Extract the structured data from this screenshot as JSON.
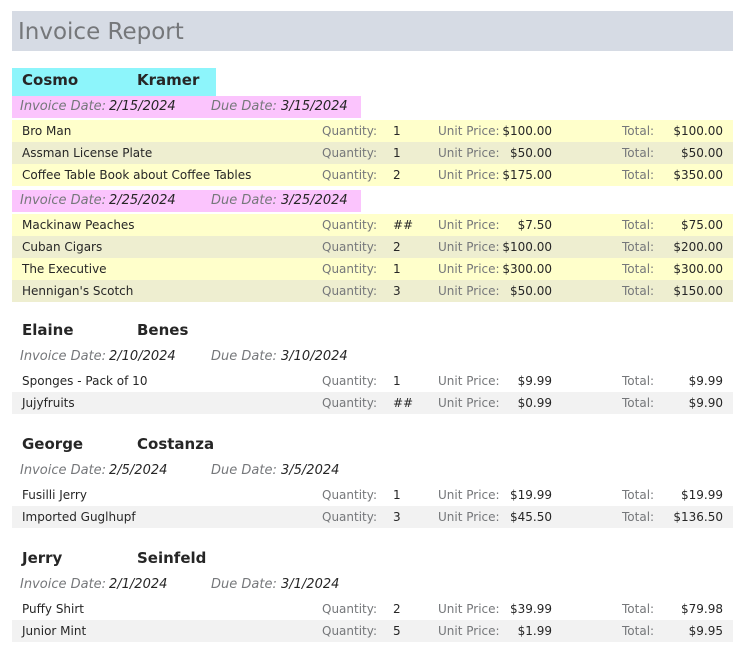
{
  "report": {
    "title": "Invoice Report"
  },
  "labels": {
    "invoice_date": "Invoice Date:",
    "due_date": "Due Date:",
    "quantity": "Quantity:",
    "unit_price": "Unit Price:",
    "total": "Total:"
  },
  "colors": {
    "title_bar": "#d6dbe4",
    "customer_highlight": "#8df5fb",
    "invoice_highlight": "#fbc4fd",
    "row_yellow_light": "#ffffcb",
    "row_yellow_dark": "#eeeed0",
    "row_gray": "#f2f2f2"
  },
  "customers": [
    {
      "first": "Cosmo",
      "last": "Kramer",
      "invoices": [
        {
          "invoice_date": "2/15/2024",
          "due_date": "3/15/2024",
          "items": [
            {
              "name": "Bro Man",
              "quantity": "1",
              "unit_price": "$100.00",
              "total": "$100.00"
            },
            {
              "name": "Assman License Plate",
              "quantity": "1",
              "unit_price": "$50.00",
              "total": "$50.00"
            },
            {
              "name": "Coffee Table Book about Coffee Tables",
              "quantity": "2",
              "unit_price": "$175.00",
              "total": "$350.00"
            }
          ]
        },
        {
          "invoice_date": "2/25/2024",
          "due_date": "3/25/2024",
          "items": [
            {
              "name": "Mackinaw Peaches",
              "quantity": "##",
              "unit_price": "$7.50",
              "total": "$75.00"
            },
            {
              "name": "Cuban Cigars",
              "quantity": "2",
              "unit_price": "$100.00",
              "total": "$200.00"
            },
            {
              "name": "The Executive",
              "quantity": "1",
              "unit_price": "$300.00",
              "total": "$300.00"
            },
            {
              "name": "Hennigan's Scotch",
              "quantity": "3",
              "unit_price": "$50.00",
              "total": "$150.00"
            }
          ]
        }
      ]
    },
    {
      "first": "Elaine",
      "last": "Benes",
      "invoices": [
        {
          "invoice_date": "2/10/2024",
          "due_date": "3/10/2024",
          "items": [
            {
              "name": "Sponges - Pack of 10",
              "quantity": "1",
              "unit_price": "$9.99",
              "total": "$9.99"
            },
            {
              "name": "Jujyfruits",
              "quantity": "##",
              "unit_price": "$0.99",
              "total": "$9.90"
            }
          ]
        }
      ]
    },
    {
      "first": "George",
      "last": "Costanza",
      "invoices": [
        {
          "invoice_date": "2/5/2024",
          "due_date": "3/5/2024",
          "items": [
            {
              "name": "Fusilli Jerry",
              "quantity": "1",
              "unit_price": "$19.99",
              "total": "$19.99"
            },
            {
              "name": "Imported Guglhupf",
              "quantity": "3",
              "unit_price": "$45.50",
              "total": "$136.50"
            }
          ]
        }
      ]
    },
    {
      "first": "Jerry",
      "last": "Seinfeld",
      "invoices": [
        {
          "invoice_date": "2/1/2024",
          "due_date": "3/1/2024",
          "items": [
            {
              "name": "Puffy Shirt",
              "quantity": "2",
              "unit_price": "$39.99",
              "total": "$79.98"
            },
            {
              "name": "Junior Mint",
              "quantity": "5",
              "unit_price": "$1.99",
              "total": "$9.95"
            }
          ]
        }
      ]
    }
  ]
}
